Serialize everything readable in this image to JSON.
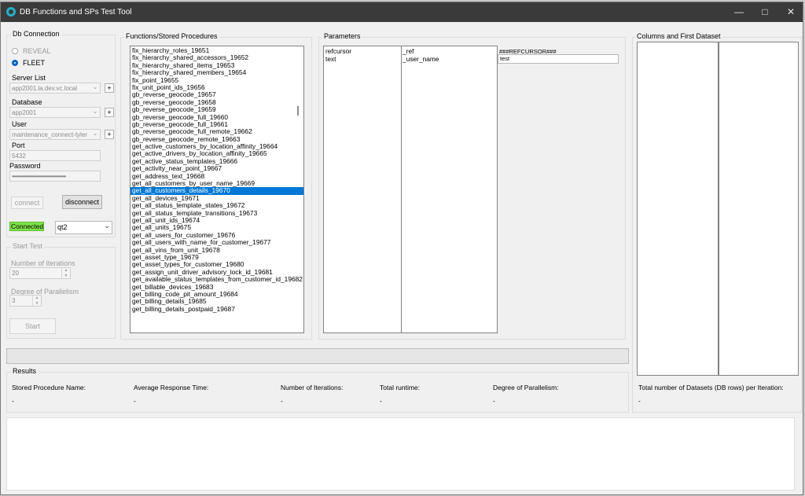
{
  "window": {
    "title": "DB Functions and SPs Test Tool"
  },
  "dbconn": {
    "group_label": "Db Connection",
    "radio_reveal": "REVEAL",
    "radio_fleet": "FLEET",
    "selected": "FLEET",
    "server_label": "Server List",
    "server_value": "app2001.la.dev.vc.local",
    "database_label": "Database",
    "database_value": "app2001",
    "user_label": "User",
    "user_value": "maintenance_connect-tyler",
    "port_label": "Port",
    "port_value": "5432",
    "password_label": "Password",
    "password_value": "••••••••••••••••••••••••••••••••••••••",
    "plus": "+",
    "connect_label": "connect",
    "disconnect_label": "disconnect",
    "status": "Connected",
    "status_color": "#7ee14a",
    "env_value": "qt2"
  },
  "start_test": {
    "group_label": "Start Test",
    "iterations_label": "Number of Iterations",
    "iterations_value": "20",
    "parallel_label": "Degree of Parallelism",
    "parallel_value": "3",
    "start_label": "Start"
  },
  "functions": {
    "group_label": "Functions/Stored Procedures",
    "selected_index": 19,
    "items": [
      "fix_hierarchy_roles_19651",
      "fix_hierarchy_shared_accessors_19652",
      "fix_hierarchy_shared_items_19653",
      "fix_hierarchy_shared_members_19654",
      "fix_point_19655",
      "fix_unit_point_ids_19656",
      "gb_reverse_geocode_19657",
      "gb_reverse_geocode_19658",
      "gb_reverse_geocode_19659",
      "gb_reverse_geocode_full_19660",
      "gb_reverse_geocode_full_19661",
      "gb_reverse_geocode_full_remote_19662",
      "gb_reverse_geocode_remote_19663",
      "get_active_customers_by_location_affinity_19664",
      "get_active_drivers_by_location_affinity_19665",
      "get_active_status_templates_19666",
      "get_activity_near_point_19667",
      "get_address_text_19668",
      "get_all_customers_by_user_name_19669",
      "get_all_customers_details_19670",
      "get_all_devices_19671",
      "get_all_status_template_states_19672",
      "get_all_status_template_transitions_19673",
      "get_all_unit_ids_19674",
      "get_all_units_19675",
      "get_all_users_for_customer_19676",
      "get_all_users_with_name_for_customer_19677",
      "get_all_vins_from_unit_19678",
      "get_asset_type_19679",
      "get_asset_types_for_customer_19680",
      "get_assign_unit_driver_advisory_lock_id_19681",
      "get_available_status_templates_from_customer_id_19682",
      "get_billable_devices_19683",
      "get_billing_code_pit_amount_19684",
      "get_billing_details_19685",
      "get_billing_details_postpaid_19687"
    ]
  },
  "parameters": {
    "group_label": "Parameters",
    "col1": [
      "refcursor",
      "text"
    ],
    "col2": [
      "_ref",
      "_user_name"
    ],
    "value_header": "###REFCURSOR###",
    "value_input": "test"
  },
  "columns": {
    "group_label": "Columns and First Dataset"
  },
  "results": {
    "group_label": "Results",
    "sp_name_label": "Stored Procedure Name:",
    "avg_label": "Average Response Time:",
    "iter_label": "Number of Iterations:",
    "runtime_label": "Total runtime:",
    "parallel_label": "Degree of Parallelism:",
    "datasets_label": "Total number of Datasets (DB rows) per Iteration:",
    "sp_name_value": "-",
    "avg_value": "-",
    "iter_value": "-",
    "runtime_value": "-",
    "parallel_value": "-",
    "datasets_value": "-"
  }
}
